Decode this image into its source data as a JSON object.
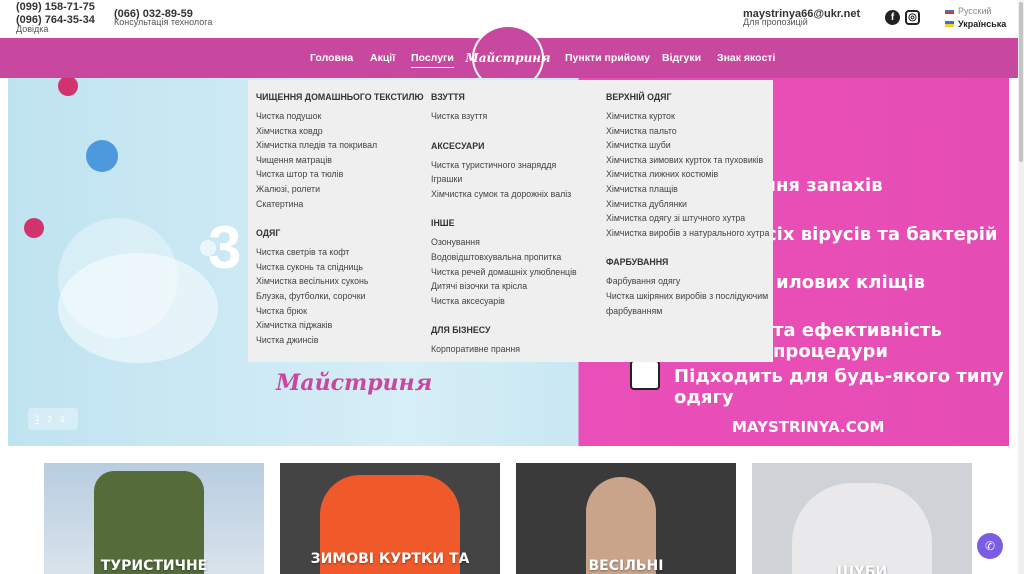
{
  "header": {
    "phone1": "(099) 158-71-75",
    "phone2": "(096) 764-35-34",
    "phone_caption": "Довідка",
    "phone3": "(066) 032-89-59",
    "phone3_caption": "Консультація технолога",
    "email": "maystrinya66@ukr.net",
    "email_caption": "Для пропозицій",
    "languages": [
      "Русский",
      "Українська"
    ],
    "active_language": "Українська"
  },
  "nav": {
    "items": [
      "Головна",
      "Акції",
      "Послуги",
      "Пункти прийому",
      "Відгуки",
      "Знак якості"
    ],
    "active": "Послуги",
    "logo_text": "Майстриня"
  },
  "dropdown": {
    "col1": {
      "sections": [
        {
          "title": "ЧИЩЕННЯ ДОМАШНЬОГО ТЕКСТИЛЮ",
          "items": [
            "Чистка подушок",
            "Хімчистка ковдр",
            "Хімчистка пледів та покривал",
            "Чищення матраців",
            "Чистка штор та тюлів",
            "Жалюзі, ролети",
            "Скатертина"
          ]
        },
        {
          "title": "ОДЯГ",
          "items": [
            "Чистка светрів та кофт",
            "Чистка суконь та спідниць",
            "Хімчистка весільних суконь",
            "Блузка, футболки, сорочки",
            "Чистка брюк",
            "Хімчистка піджаків",
            "Чистка джинсів"
          ]
        }
      ]
    },
    "col2": {
      "sections": [
        {
          "title": "ВЗУТТЯ",
          "items": [
            "Чистка взуття"
          ]
        },
        {
          "title": "АКСЕСУАРИ",
          "items": [
            "Чистка туристичного знаряддя",
            "Іграшки",
            "Хімчистка сумок та дорожніх валіз"
          ]
        },
        {
          "title": "ІНШЕ",
          "items": [
            "Озонування",
            "Водовідштовхувальна пропитка",
            "Чистка речей домашніх улюбленців",
            "Дитячі візочки та крісла",
            "Чистка аксесуарів"
          ]
        },
        {
          "title": "ДЛЯ БІЗНЕСУ",
          "items": [
            "Корпоративне прання"
          ]
        }
      ]
    },
    "col3": {
      "sections": [
        {
          "title": "ВЕРХНІЙ ОДЯГ",
          "items": [
            "Хімчистка курток",
            "Хімчистка пальто",
            "Хімчистка шуби",
            "Хімчистка зимових курток та пуховиків",
            "Хімчистка лижних костюмів",
            "Хімчистка плащів",
            "Хімчистка дублянки",
            "Хімчистка одягу зі штучного хутра",
            "Хімчистка виробів з натурального хутра"
          ]
        },
        {
          "title": "ФАРБУВАННЯ",
          "items": [
            "Фарбування одягу",
            "Чистка шкіряних виробів з послідуючим фарбуванням"
          ]
        }
      ]
    }
  },
  "hero": {
    "lines": [
      "вання запахів",
      "сіх вірусів та бактерій",
      "илових кліщів",
      "та ефективність процедури",
      "Підходить для будь-якого типу одягу"
    ],
    "site": "MAYSTRINYA.COM",
    "big_digit": "3",
    "logo": "Майстриня",
    "slides": [
      "1",
      "2",
      "3"
    ],
    "active_slide": "1"
  },
  "cards": [
    {
      "title": "ТУРИСТИЧНЕ"
    },
    {
      "title": "ЗИМОВІ КУРТКИ ТА"
    },
    {
      "title": "ВЕСІЛЬНІ"
    },
    {
      "title": "ШУБИ"
    }
  ]
}
